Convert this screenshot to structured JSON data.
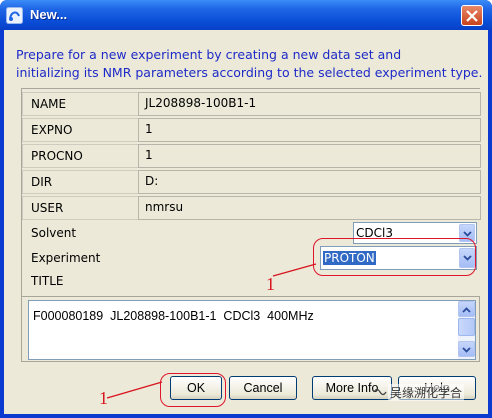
{
  "window": {
    "title": "New..."
  },
  "description": [
    "Prepare for a new experiment by creating a new data set and",
    "initializing its NMR parameters according to the selected experiment type."
  ],
  "fields": [
    {
      "label": "NAME",
      "value": "JL208898-100B1-1"
    },
    {
      "label": "EXPNO",
      "value": "1"
    },
    {
      "label": "PROCNO",
      "value": "1"
    },
    {
      "label": "DIR",
      "value": "D:"
    },
    {
      "label": "USER",
      "value": "nmrsu"
    }
  ],
  "solvent": {
    "label": "Solvent",
    "value": "CDCl3"
  },
  "experiment": {
    "label": "Experiment",
    "value": "PROTON"
  },
  "title_field": {
    "label": "TITLE",
    "value": "F000080189  JL208898-100B1-1  CDCl3  400MHz"
  },
  "buttons": {
    "ok": "OK",
    "cancel": "Cancel",
    "more_info": "More Info",
    "help": "Help"
  },
  "annotations": {
    "experiment_marker": "1",
    "ok_marker": "1"
  },
  "watermark": "吴缘溯化学合",
  "colors": {
    "title_bar": "#0a4ed8",
    "description_text": "#1d2ac8",
    "annotation": "#e0142a",
    "selection": "#316ac5"
  },
  "icons": [
    "app-icon",
    "close-icon",
    "chevron-down-icon",
    "scroll-up-icon",
    "scroll-down-icon"
  ]
}
